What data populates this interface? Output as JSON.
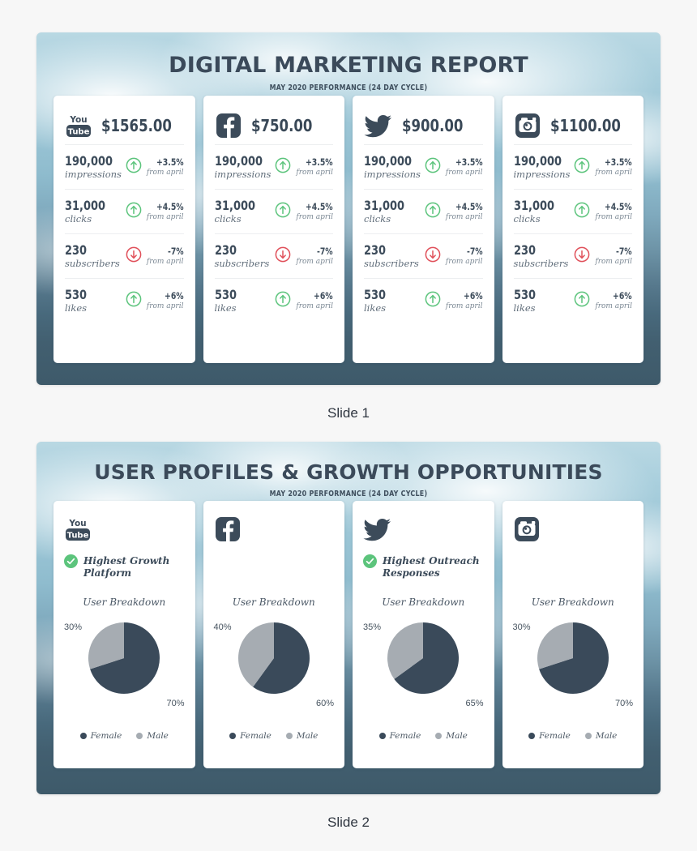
{
  "theme": {
    "navy": "#3c4b5a",
    "green": "#5cc47c",
    "red": "#e0505a",
    "pie_female": "#3a4a5a",
    "pie_male": "#a6acb2",
    "card_bg": "#ffffff",
    "page_bg": "#f7f7f7"
  },
  "slides": [
    {
      "caption": "Slide 1",
      "title": "DIGITAL MARKETING REPORT",
      "subtitle": "MAY 2020 PERFORMANCE (24 DAY CYCLE)",
      "cards": [
        {
          "platform": "youtube",
          "icon": "youtube-icon",
          "amount": "$1565.00",
          "metrics": [
            {
              "value": "190,000",
              "label": "impressions",
              "delta": "+3.5%",
              "from": "from april",
              "direction": "up"
            },
            {
              "value": "31,000",
              "label": "clicks",
              "delta": "+4.5%",
              "from": "from april",
              "direction": "up"
            },
            {
              "value": "230",
              "label": "subscribers",
              "delta": "-7%",
              "from": "from april",
              "direction": "down"
            },
            {
              "value": "530",
              "label": "likes",
              "delta": "+6%",
              "from": "from april",
              "direction": "up"
            }
          ]
        },
        {
          "platform": "facebook",
          "icon": "facebook-icon",
          "amount": "$750.00",
          "metrics": [
            {
              "value": "190,000",
              "label": "impressions",
              "delta": "+3.5%",
              "from": "from april",
              "direction": "up"
            },
            {
              "value": "31,000",
              "label": "clicks",
              "delta": "+4.5%",
              "from": "from april",
              "direction": "up"
            },
            {
              "value": "230",
              "label": "subscribers",
              "delta": "-7%",
              "from": "from april",
              "direction": "down"
            },
            {
              "value": "530",
              "label": "likes",
              "delta": "+6%",
              "from": "from april",
              "direction": "up"
            }
          ]
        },
        {
          "platform": "twitter",
          "icon": "twitter-icon",
          "amount": "$900.00",
          "metrics": [
            {
              "value": "190,000",
              "label": "impressions",
              "delta": "+3.5%",
              "from": "from april",
              "direction": "up"
            },
            {
              "value": "31,000",
              "label": "clicks",
              "delta": "+4.5%",
              "from": "from april",
              "direction": "up"
            },
            {
              "value": "230",
              "label": "subscribers",
              "delta": "-7%",
              "from": "from april",
              "direction": "down"
            },
            {
              "value": "530",
              "label": "likes",
              "delta": "+6%",
              "from": "from april",
              "direction": "up"
            }
          ]
        },
        {
          "platform": "instagram",
          "icon": "instagram-icon",
          "amount": "$1100.00",
          "metrics": [
            {
              "value": "190,000",
              "label": "impressions",
              "delta": "+3.5%",
              "from": "from april",
              "direction": "up"
            },
            {
              "value": "31,000",
              "label": "clicks",
              "delta": "+4.5%",
              "from": "from april",
              "direction": "up"
            },
            {
              "value": "230",
              "label": "subscribers",
              "delta": "-7%",
              "from": "from april",
              "direction": "down"
            },
            {
              "value": "530",
              "label": "likes",
              "delta": "+6%",
              "from": "from april",
              "direction": "up"
            }
          ]
        }
      ]
    },
    {
      "caption": "Slide 2",
      "title": "USER PROFILES & GROWTH OPPORTUNITIES",
      "subtitle": "MAY 2020 PERFORMANCE (24 DAY CYCLE)",
      "cards": [
        {
          "platform": "youtube",
          "icon": "youtube-icon",
          "badge": "Highest Growth Platform",
          "has_badge": true,
          "breakdown_title": "User Breakdown",
          "left_pct": "30%",
          "right_pct": "70%",
          "legend": [
            "Female",
            "Male"
          ]
        },
        {
          "platform": "facebook",
          "icon": "facebook-icon",
          "badge": "",
          "has_badge": false,
          "breakdown_title": "User Breakdown",
          "left_pct": "40%",
          "right_pct": "60%",
          "legend": [
            "Female",
            "Male"
          ]
        },
        {
          "platform": "twitter",
          "icon": "twitter-icon",
          "badge": "Highest Outreach Responses",
          "has_badge": true,
          "breakdown_title": "User Breakdown",
          "left_pct": "35%",
          "right_pct": "65%",
          "legend": [
            "Female",
            "Male"
          ]
        },
        {
          "platform": "instagram",
          "icon": "instagram-icon",
          "badge": "",
          "has_badge": false,
          "breakdown_title": "User Breakdown",
          "left_pct": "30%",
          "right_pct": "70%",
          "legend": [
            "Female",
            "Male"
          ]
        }
      ]
    }
  ],
  "chart_data": [
    {
      "type": "pie",
      "title": "User Breakdown",
      "platform": "YouTube",
      "labels": [
        "Female",
        "Male"
      ],
      "values": [
        70,
        30
      ],
      "value_labels": [
        "70%",
        "30%"
      ],
      "colors": [
        "#3a4a5a",
        "#a6acb2"
      ],
      "legend_position": "bottom"
    },
    {
      "type": "pie",
      "title": "User Breakdown",
      "platform": "Facebook",
      "labels": [
        "Female",
        "Male"
      ],
      "values": [
        60,
        40
      ],
      "value_labels": [
        "60%",
        "40%"
      ],
      "colors": [
        "#3a4a5a",
        "#a6acb2"
      ],
      "legend_position": "bottom"
    },
    {
      "type": "pie",
      "title": "User Breakdown",
      "platform": "Twitter",
      "labels": [
        "Female",
        "Male"
      ],
      "values": [
        65,
        35
      ],
      "value_labels": [
        "65%",
        "35%"
      ],
      "colors": [
        "#3a4a5a",
        "#a6acb2"
      ],
      "legend_position": "bottom"
    },
    {
      "type": "pie",
      "title": "User Breakdown",
      "platform": "Instagram",
      "labels": [
        "Female",
        "Male"
      ],
      "values": [
        70,
        30
      ],
      "value_labels": [
        "70%",
        "30%"
      ],
      "colors": [
        "#3a4a5a",
        "#a6acb2"
      ],
      "legend_position": "bottom"
    }
  ]
}
